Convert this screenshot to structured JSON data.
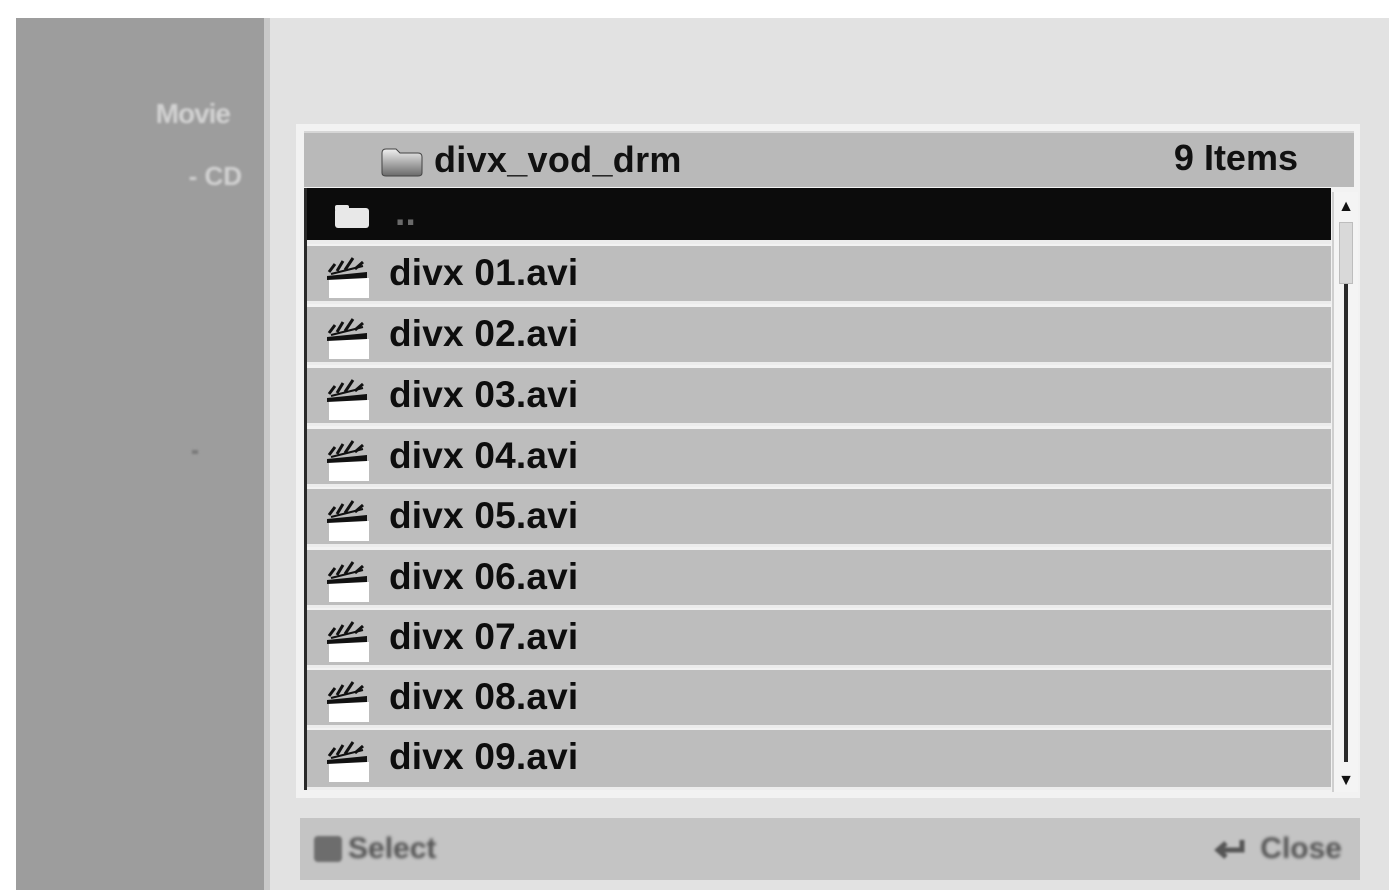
{
  "sidebar": {
    "title": "Movie",
    "subtitle": "- CD"
  },
  "header": {
    "folder_name": "divx_vod_drm",
    "item_count": "9 Items"
  },
  "list": {
    "parent_label": "..",
    "files": [
      "divx 01.avi",
      "divx 02.avi",
      "divx 03.avi",
      "divx 04.avi",
      "divx 05.avi",
      "divx 06.avi",
      "divx 07.avi",
      "divx 08.avi",
      "divx 09.avi"
    ]
  },
  "footer": {
    "left_label": "Select",
    "right_label": "Close"
  },
  "icons": {
    "folder": "folder-icon",
    "file": "movie-clapper-icon",
    "scroll_up": "arrow-up-icon",
    "scroll_down": "arrow-down-icon"
  },
  "colors": {
    "row_bg": "#bdbdbd",
    "selected_bg": "#0c0c0c",
    "sidebar_bg": "#9d9d9d",
    "screen_bg": "#e2e2e2"
  }
}
